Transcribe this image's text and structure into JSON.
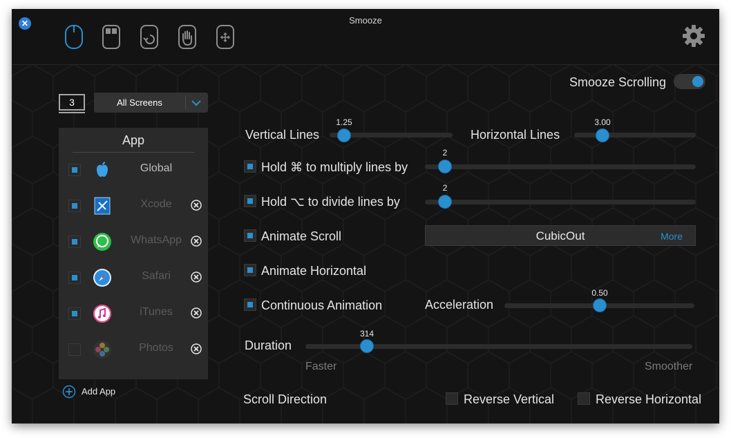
{
  "window": {
    "title": "Smooze"
  },
  "toolbar": {
    "tools": [
      {
        "icon": "mouse-scroll-icon",
        "active": true
      },
      {
        "icon": "mouse-buttons-icon",
        "active": false
      },
      {
        "icon": "mouse-gesture-icon",
        "active": false
      },
      {
        "icon": "grab-hand-icon",
        "active": false
      },
      {
        "icon": "mouse-move-icon",
        "active": false
      }
    ],
    "settings_icon": "gear-icon"
  },
  "smooze_scrolling": {
    "label": "Smooze Scrolling",
    "on": true
  },
  "screen": {
    "count": "3",
    "selected": "All Screens"
  },
  "app_list": {
    "header": "App",
    "apps": [
      {
        "name": "Global",
        "checked": true,
        "enabled": true,
        "icon": "apple-icon",
        "removable": false
      },
      {
        "name": "Xcode",
        "checked": true,
        "enabled": false,
        "icon": "xcode-icon",
        "removable": true
      },
      {
        "name": "WhatsApp",
        "checked": true,
        "enabled": false,
        "icon": "whatsapp-icon",
        "removable": true
      },
      {
        "name": "Safari",
        "checked": true,
        "enabled": false,
        "icon": "safari-icon",
        "removable": true
      },
      {
        "name": "iTunes",
        "checked": true,
        "enabled": false,
        "icon": "itunes-icon",
        "removable": true
      },
      {
        "name": "Photos",
        "checked": false,
        "enabled": false,
        "icon": "photos-icon",
        "removable": true
      }
    ],
    "add_label": "Add App"
  },
  "vertical_lines": {
    "label": "Vertical Lines",
    "value": "1.25",
    "fraction": 0.13
  },
  "horizontal_lines": {
    "label": "Horizontal Lines",
    "value": "3.00",
    "fraction": 0.23
  },
  "hold_cmd": {
    "label": "Hold ⌘ to multiply lines by",
    "value": "2",
    "checked": true,
    "fraction": 0.05
  },
  "hold_opt": {
    "label": "Hold ⌥ to divide lines by",
    "value": "2",
    "checked": true,
    "fraction": 0.05
  },
  "animate_scroll": {
    "label": "Animate Scroll",
    "checked": true,
    "easing": "CubicOut",
    "more": "More"
  },
  "animate_horizontal": {
    "label": "Animate Horizontal",
    "checked": true
  },
  "continuous_animation": {
    "label": "Continuous Animation",
    "checked": true
  },
  "acceleration": {
    "label": "Acceleration",
    "value": "0.50",
    "fraction": 0.5
  },
  "duration": {
    "label": "Duration",
    "value": "314",
    "fraction": 0.16,
    "min_label": "Faster",
    "max_label": "Smoother"
  },
  "scroll_direction": {
    "label": "Scroll Direction",
    "reverse_vertical": {
      "label": "Reverse Vertical",
      "checked": false
    },
    "reverse_horizontal": {
      "label": "Reverse Horizontal",
      "checked": false
    }
  },
  "colors": {
    "accent": "#2a8fd0",
    "background": "#141414",
    "panel": "#2a2a2a"
  }
}
